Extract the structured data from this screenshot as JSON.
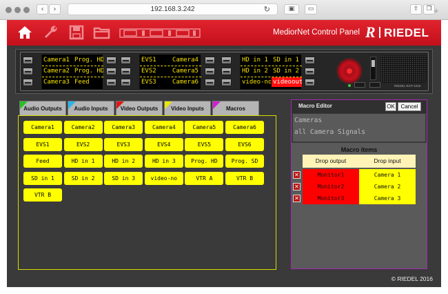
{
  "browser": {
    "url": "192.168.3.242",
    "back_icon": "chevron-left-icon",
    "forward_icon": "chevron-right-icon",
    "reload_icon": "reload-icon"
  },
  "header": {
    "app_name": "MediorNet Control Panel",
    "brand_mark": "R",
    "brand_name": "RIEDEL",
    "accent_color": "#d41a24",
    "toolbar_icons": [
      "home-icon",
      "wrench-icon",
      "save-icon",
      "folder-icon",
      "patch-icon"
    ]
  },
  "hardware_panel": {
    "model_label": "RIEDEL RCP-1016",
    "displays": [
      {
        "rows": [
          [
            "Camera1",
            "Prog. HD"
          ],
          [
            "Camera2",
            "Prog. HD"
          ],
          [
            "Camera3",
            "Feed"
          ]
        ]
      },
      {
        "rows": [
          [
            "EVS1",
            "Camera4"
          ],
          [
            "EVS2",
            "Camera5"
          ],
          [
            "EVS3",
            "Camera6"
          ]
        ]
      },
      {
        "rows": [
          [
            "HD in 1",
            "SD in 1"
          ],
          [
            "HD in 2",
            "SD in 2"
          ],
          [
            "video-no",
            "videoout"
          ]
        ]
      }
    ],
    "highlight_cell": "videoout"
  },
  "tabs": [
    {
      "label": "Audio Outputs",
      "color": "#26c026"
    },
    {
      "label": "Audio Inputs",
      "color": "#29b4e8"
    },
    {
      "label": "Video Outputs",
      "color": "#e01818"
    },
    {
      "label": "Video Inputs",
      "color": "#e8e800"
    },
    {
      "label": "Macros",
      "color": "#d020d0"
    }
  ],
  "sources": [
    "Camera1",
    "Camera2",
    "Camera3",
    "Camera4",
    "Camera5",
    "Camera6",
    "EVS1",
    "EVS2",
    "EVS3",
    "EVS4",
    "EVS5",
    "EVS6",
    "Feed",
    "HD in 1",
    "HD in 2",
    "HD in 3",
    "Prog. HD",
    "Prog. SD",
    "SD in 1",
    "SD in 2",
    "SD in 3",
    "video-no",
    "VTR A",
    "VTR B",
    "VTR B"
  ],
  "macro_editor": {
    "title": "Macro Editor",
    "ok_label": "OK",
    "cancel_label": "Cancel",
    "name": "Cameras",
    "description": "all Camera Signals",
    "items_title": "Macro items",
    "col_output": "Drop output",
    "col_input": "Drop input",
    "delete_icon": "delete-x-icon",
    "items": [
      {
        "output": "Monitor1",
        "input": "Camera 1"
      },
      {
        "output": "Monitor2",
        "input": "Camera 2"
      },
      {
        "output": "Monitor3",
        "input": "Camera 3"
      }
    ]
  },
  "footer": {
    "copyright": "© RIEDEL 2016"
  }
}
